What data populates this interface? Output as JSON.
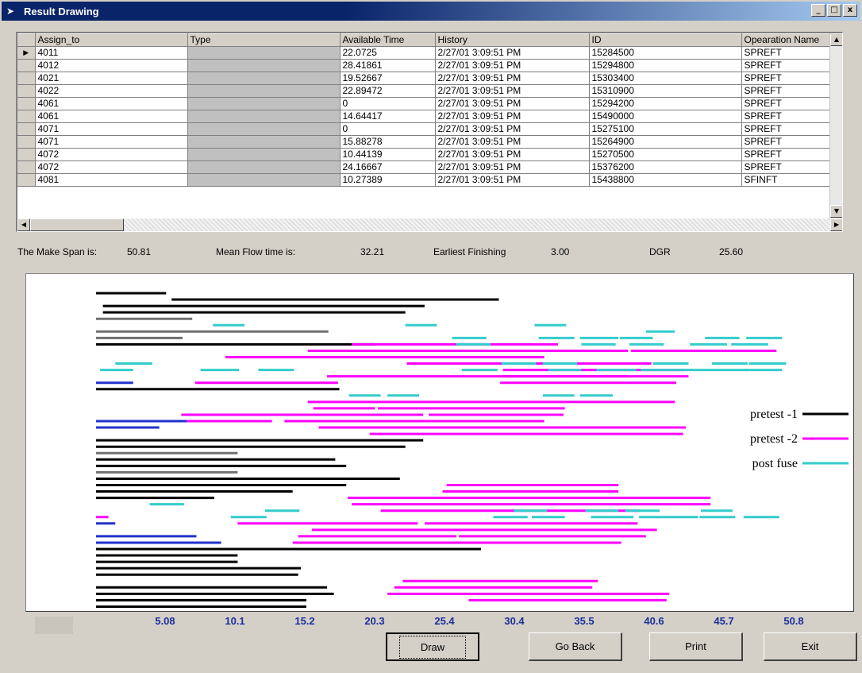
{
  "window": {
    "title": "Result Drawing",
    "minimize": "_",
    "maximize": "□",
    "close": "x"
  },
  "grid": {
    "columns": [
      "Assign_to",
      "Type",
      "Available Time",
      "History",
      "ID",
      "Opearation Name"
    ],
    "rows": [
      [
        "4011",
        "",
        "22.0725",
        "2/27/01 3:09:51 PM",
        "15284500",
        "SPREFT"
      ],
      [
        "4012",
        "",
        "28.41861",
        "2/27/01 3:09:51 PM",
        "15294800",
        "SPREFT"
      ],
      [
        "4021",
        "",
        "19.52667",
        "2/27/01 3:09:51 PM",
        "15303400",
        "SPREFT"
      ],
      [
        "4022",
        "",
        "22.89472",
        "2/27/01 3:09:51 PM",
        "15310900",
        "SPREFT"
      ],
      [
        "4061",
        "",
        "0",
        "2/27/01 3:09:51 PM",
        "15294200",
        "SPREFT"
      ],
      [
        "4061",
        "",
        "14.64417",
        "2/27/01 3:09:51 PM",
        "15490000",
        "SPREFT"
      ],
      [
        "4071",
        "",
        "0",
        "2/27/01 3:09:51 PM",
        "15275100",
        "SPREFT"
      ],
      [
        "4071",
        "",
        "15.88278",
        "2/27/01 3:09:51 PM",
        "15264900",
        "SPREFT"
      ],
      [
        "4072",
        "",
        "10.44139",
        "2/27/01 3:09:51 PM",
        "15270500",
        "SPREFT"
      ],
      [
        "4072",
        "",
        "24.16667",
        "2/27/01 3:09:51 PM",
        "15376200",
        "SPREFT"
      ],
      [
        "4081",
        "",
        "10.27389",
        "2/27/01 3:09:51 PM",
        "15438800",
        "SFINFT"
      ]
    ]
  },
  "stats": {
    "make_span_label": "The Make Span is:",
    "make_span_value": "50.81",
    "mean_flow_label": "Mean Flow time is:",
    "mean_flow_value": "32.21",
    "earliest_label": "Earliest Finishing",
    "earliest_value": "3.00",
    "dgr_label": "DGR",
    "dgr_value": "25.60"
  },
  "chart_data": {
    "type": "gantt",
    "xlim": [
      0,
      50.81
    ],
    "tick_labels": [
      "5.08",
      "10.1",
      "15.2",
      "20.3",
      "25.4",
      "30.4",
      "35.5",
      "40.6",
      "45.7",
      "50.8"
    ],
    "legend": [
      {
        "name": "pretest -1",
        "color": "#000000"
      },
      {
        "name": "pretest -2",
        "color": "#ff00ff"
      },
      {
        "name": "post fuse",
        "color": "#33cccc"
      }
    ],
    "colors": {
      "pretest-1": "#000000",
      "pretest-1-gray": "#707070",
      "pretest-2": "#ff00ff",
      "post-fuse": "#33cccc",
      "other": "#2233cc"
    },
    "rows": [
      [
        [
          "pretest-1",
          0.0,
          5.1
        ]
      ],
      [
        [
          "pretest-1",
          5.5,
          29.3
        ]
      ],
      [
        [
          "pretest-1",
          0.5,
          23.9
        ]
      ],
      [
        [
          "pretest-1",
          0.5,
          22.5
        ]
      ],
      [
        [
          "pretest-1-gray",
          0.0,
          7.0
        ]
      ],
      [
        [
          "post-fuse",
          8.5,
          10.8
        ],
        [
          "post-fuse",
          22.5,
          24.8
        ],
        [
          "post-fuse",
          31.9,
          34.2
        ]
      ],
      [
        [
          "pretest-1-gray",
          0.0,
          16.9
        ],
        [
          "post-fuse",
          40.0,
          42.1
        ]
      ],
      [
        [
          "pretest-1-gray",
          0.0,
          6.3
        ],
        [
          "post-fuse",
          25.9,
          28.4
        ],
        [
          "post-fuse",
          32.2,
          34.8
        ],
        [
          "post-fuse",
          35.2,
          38.0
        ],
        [
          "post-fuse",
          38.1,
          40.5
        ],
        [
          "post-fuse",
          44.3,
          46.8
        ],
        [
          "post-fuse",
          47.3,
          49.9
        ]
      ],
      [
        [
          "pretest-1",
          0.0,
          20.3
        ],
        [
          "pretest-2",
          18.6,
          33.6
        ],
        [
          "post-fuse",
          26.2,
          28.7
        ],
        [
          "post-fuse",
          35.3,
          37.8
        ],
        [
          "post-fuse",
          38.8,
          41.3
        ],
        [
          "post-fuse",
          43.2,
          45.9
        ],
        [
          "post-fuse",
          46.2,
          48.9
        ]
      ],
      [
        [
          "pretest-2",
          15.4,
          38.7
        ],
        [
          "pretest-2",
          38.9,
          49.5
        ]
      ],
      [
        [
          "pretest-2",
          9.4,
          32.6
        ]
      ],
      [
        [
          "post-fuse",
          1.4,
          4.1
        ],
        [
          "pretest-2",
          22.6,
          40.4
        ],
        [
          "post-fuse",
          29.5,
          32.0
        ],
        [
          "post-fuse",
          32.5,
          35.0
        ],
        [
          "post-fuse",
          40.5,
          43.1
        ],
        [
          "post-fuse",
          44.8,
          47.4
        ],
        [
          "post-fuse",
          47.5,
          50.2
        ]
      ],
      [
        [
          "post-fuse",
          0.3,
          2.7
        ],
        [
          "post-fuse",
          7.6,
          10.4
        ],
        [
          "post-fuse",
          11.8,
          14.4
        ],
        [
          "post-fuse",
          26.6,
          29.2
        ],
        [
          "pretest-2",
          29.6,
          42.8
        ],
        [
          "post-fuse",
          32.9,
          35.3
        ],
        [
          "post-fuse",
          36.4,
          39.3
        ],
        [
          "post-fuse",
          39.6,
          47.4
        ],
        [
          "post-fuse",
          47.2,
          49.9
        ]
      ],
      [
        [
          "pretest-2",
          16.8,
          38.7
        ],
        [
          "pretest-2",
          29.6,
          43.1
        ]
      ],
      [
        [
          "other",
          0.0,
          2.7
        ],
        [
          "pretest-2",
          7.2,
          17.6
        ],
        [
          "pretest-2",
          29.4,
          42.2
        ]
      ],
      [
        [
          "pretest-1",
          0.0,
          17.7
        ]
      ],
      [
        [
          "post-fuse",
          18.4,
          20.7
        ],
        [
          "post-fuse",
          21.2,
          23.5
        ],
        [
          "post-fuse",
          32.5,
          34.8
        ],
        [
          "post-fuse",
          35.2,
          37.6
        ]
      ],
      [
        [
          "pretest-2",
          15.4,
          42.1
        ]
      ],
      [
        [
          "pretest-2",
          15.8,
          20.3
        ],
        [
          "pretest-2",
          20.5,
          34.1
        ]
      ],
      [
        [
          "pretest-2",
          6.2,
          23.8
        ],
        [
          "pretest-2",
          24.2,
          34.0
        ]
      ],
      [
        [
          "other",
          0.0,
          8.5
        ],
        [
          "pretest-2",
          6.6,
          12.8
        ],
        [
          "pretest-2",
          13.7,
          32.6
        ]
      ],
      [
        [
          "other",
          0.0,
          4.6
        ],
        [
          "pretest-2",
          16.2,
          42.9
        ]
      ],
      [
        [
          "pretest-2",
          19.9,
          42.7
        ]
      ],
      [
        [
          "pretest-1",
          0.0,
          23.8
        ]
      ],
      [
        [
          "pretest-1",
          0.0,
          22.5
        ]
      ],
      [
        [
          "pretest-1-gray",
          0.0,
          10.3
        ]
      ],
      [
        [
          "pretest-1",
          0.0,
          17.4
        ]
      ],
      [
        [
          "pretest-1",
          0.0,
          18.2
        ]
      ],
      [
        [
          "pretest-1-gray",
          0.0,
          10.3
        ]
      ],
      [
        [
          "pretest-1",
          0.0,
          22.1
        ]
      ],
      [
        [
          "pretest-1",
          0.0,
          18.2
        ],
        [
          "pretest-2",
          25.5,
          38.0
        ]
      ],
      [
        [
          "pretest-1",
          0.0,
          14.3
        ],
        [
          "pretest-2",
          25.2,
          38.0
        ]
      ],
      [
        [
          "pretest-1",
          0.0,
          8.6
        ],
        [
          "pretest-2",
          18.3,
          44.7
        ]
      ],
      [
        [
          "post-fuse",
          3.9,
          6.4
        ],
        [
          "pretest-2",
          18.6,
          44.7
        ]
      ],
      [
        [
          "post-fuse",
          12.3,
          14.8
        ],
        [
          "pretest-2",
          20.7,
          39.6
        ],
        [
          "post-fuse",
          30.4,
          32.8
        ],
        [
          "post-fuse",
          35.6,
          38.0
        ],
        [
          "post-fuse",
          38.5,
          41.0
        ],
        [
          "post-fuse",
          44.0,
          46.3
        ]
      ],
      [
        [
          "pretest-2",
          0.0,
          0.9
        ],
        [
          "post-fuse",
          9.8,
          12.4
        ],
        [
          "post-fuse",
          28.9,
          31.4
        ],
        [
          "post-fuse",
          31.7,
          34.1
        ],
        [
          "post-fuse",
          36.0,
          39.1
        ],
        [
          "post-fuse",
          39.5,
          43.8
        ],
        [
          "post-fuse",
          43.9,
          46.5
        ],
        [
          "post-fuse",
          47.1,
          49.7
        ]
      ],
      [
        [
          "other",
          0.0,
          1.4
        ],
        [
          "pretest-2",
          10.3,
          23.4
        ],
        [
          "pretest-2",
          23.9,
          39.4
        ]
      ],
      [
        [
          "pretest-2",
          15.7,
          40.8
        ]
      ],
      [
        [
          "other",
          0.0,
          7.3
        ],
        [
          "pretest-2",
          14.7,
          26.2
        ],
        [
          "pretest-2",
          26.4,
          40.0
        ]
      ],
      [
        [
          "other",
          0.0,
          9.1
        ],
        [
          "pretest-2",
          14.3,
          38.2
        ]
      ],
      [
        [
          "pretest-1",
          0.0,
          28.0
        ]
      ],
      [
        [
          "pretest-1",
          0.0,
          10.3
        ]
      ],
      [
        [
          "pretest-1",
          0.0,
          10.3
        ]
      ],
      [
        [
          "pretest-1",
          0.0,
          14.9
        ]
      ],
      [
        [
          "pretest-1",
          0.0,
          14.7
        ]
      ],
      [
        [
          "pretest-2",
          22.3,
          36.5
        ]
      ],
      [
        [
          "pretest-1",
          0.0,
          16.8
        ],
        [
          "pretest-2",
          21.7,
          36.1
        ]
      ],
      [
        [
          "pretest-1",
          0.0,
          17.3
        ],
        [
          "pretest-2",
          21.2,
          41.7
        ]
      ],
      [
        [
          "pretest-1",
          0.0,
          15.3
        ],
        [
          "pretest-2",
          27.1,
          41.5
        ]
      ],
      [
        [
          "pretest-1",
          0.0,
          15.3
        ]
      ]
    ]
  },
  "buttons": {
    "draw": "Draw",
    "go_back": "Go Back",
    "print": "Print",
    "exit": "Exit"
  }
}
